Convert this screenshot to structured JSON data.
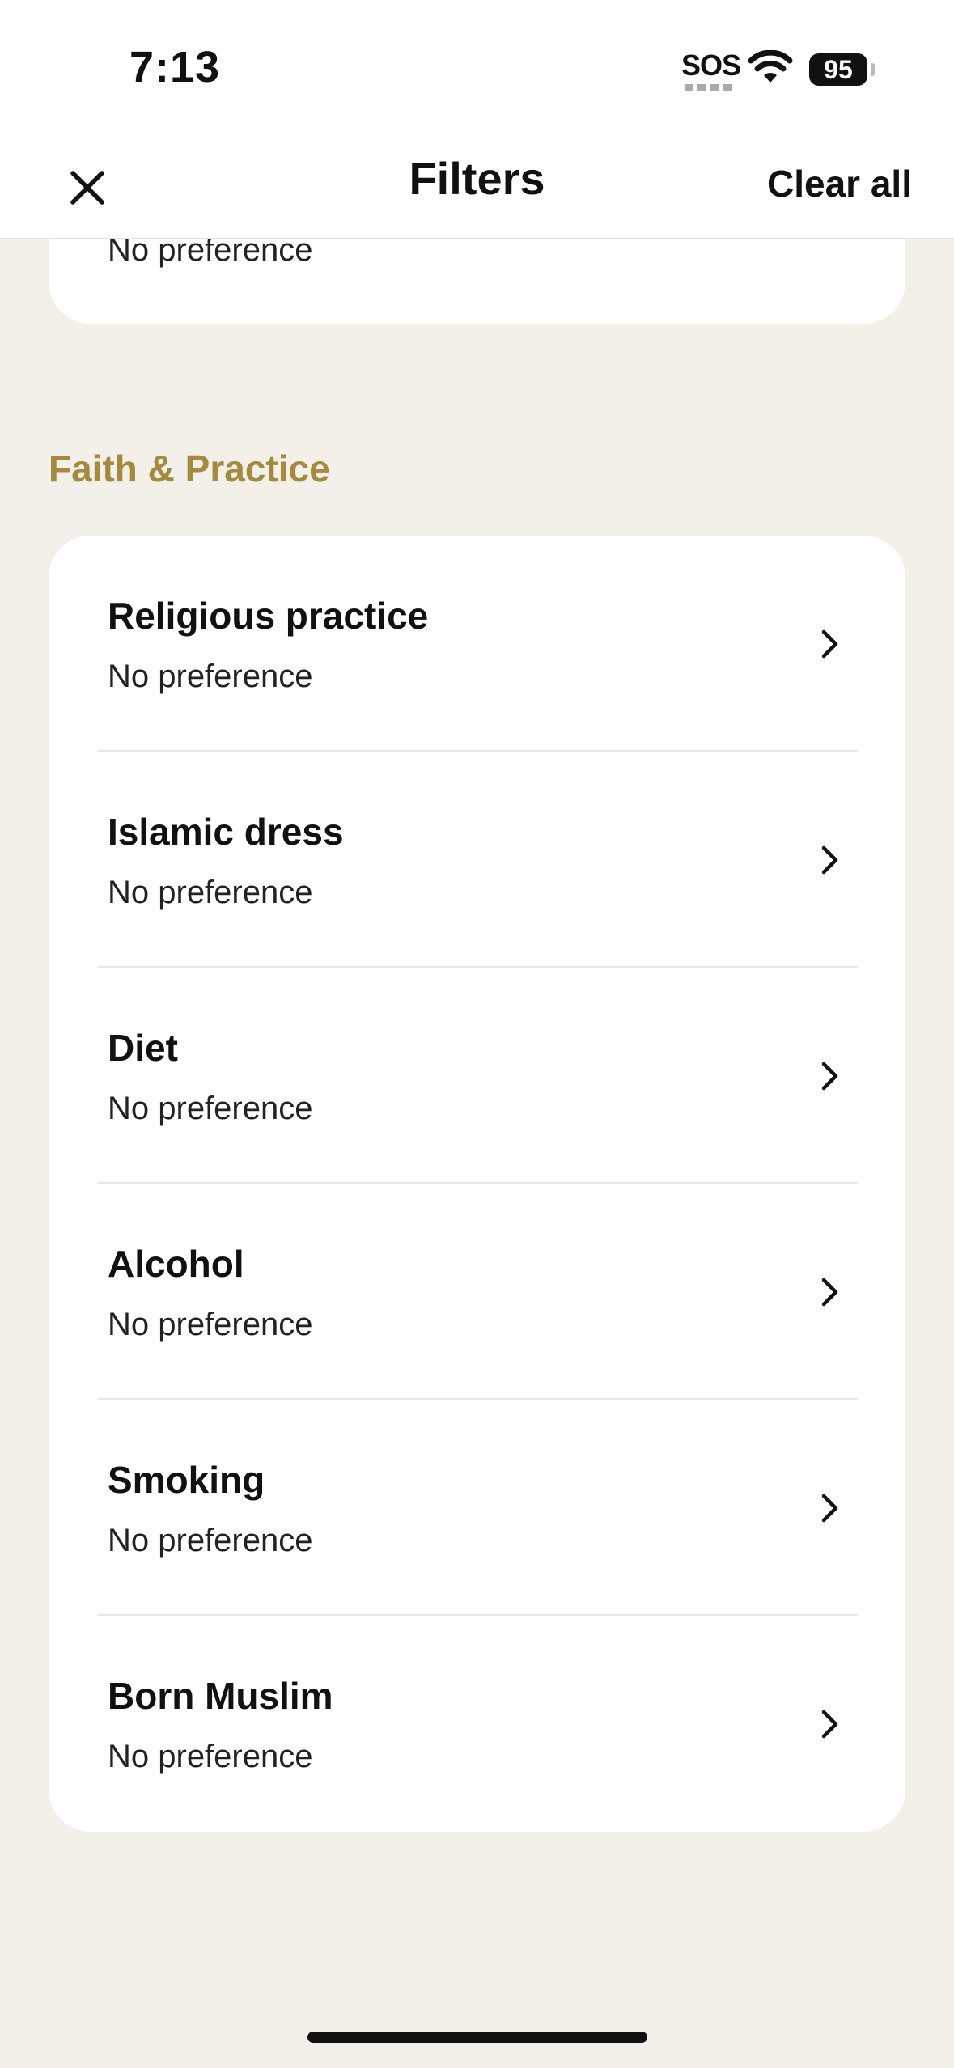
{
  "status": {
    "time": "7:13",
    "sos": "SOS",
    "battery": "95"
  },
  "nav": {
    "title": "Filters",
    "clear_label": "Clear all"
  },
  "previous_row": {
    "value": "No preference"
  },
  "section": {
    "title": "Faith & Practice"
  },
  "rows": [
    {
      "label": "Religious practice",
      "value": "No preference"
    },
    {
      "label": "Islamic dress",
      "value": "No preference"
    },
    {
      "label": "Diet",
      "value": "No preference"
    },
    {
      "label": "Alcohol",
      "value": "No preference"
    },
    {
      "label": "Smoking",
      "value": "No preference"
    },
    {
      "label": "Born Muslim",
      "value": "No preference"
    }
  ],
  "colors": {
    "accent": "#a38a3c",
    "background": "#f3f0ea",
    "card": "#ffffff"
  }
}
